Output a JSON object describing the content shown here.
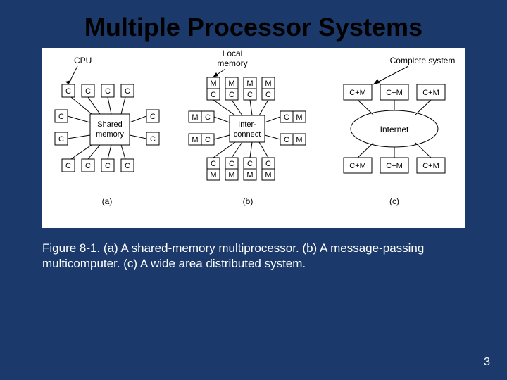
{
  "title": "Multiple Processor Systems",
  "caption": "Figure 8-1. (a) A shared-memory multiprocessor. (b) A message-passing multicomputer. (c) A wide area distributed system.",
  "page_number": "3",
  "diagrams": {
    "a": {
      "label": "(a)",
      "cpu_pointer": "CPU",
      "center": "Shared\nmemory",
      "nodes": [
        "C",
        "C",
        "C",
        "C",
        "C",
        "C",
        "C",
        "C",
        "C",
        "C",
        "C",
        "C"
      ]
    },
    "b": {
      "label": "(b)",
      "localmem_pointer": "Local\nmemory",
      "center": "Inter-\nconnect",
      "mem": "M",
      "cpu": "C"
    },
    "c": {
      "label": "(c)",
      "complete_pointer": "Complete system",
      "center": "Internet",
      "node": "C+M"
    }
  }
}
